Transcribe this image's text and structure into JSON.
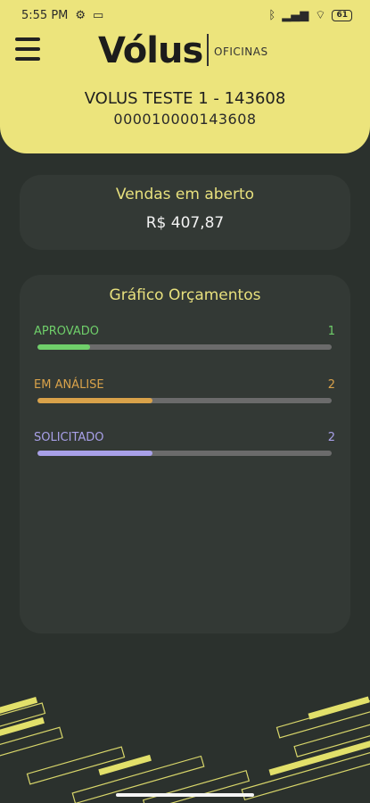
{
  "status_bar": {
    "time": "5:55 PM",
    "battery": "61"
  },
  "header": {
    "logo_text": "Vólus",
    "logo_sub": "OFICINAS",
    "account_name": "VOLUS TESTE 1 - 143608",
    "account_number": "000010000143608"
  },
  "sales": {
    "title": "Vendas em aberto",
    "value": "R$ 407,87"
  },
  "chart": {
    "title": "Gráfico Orçamentos",
    "colors": {
      "accent": "#e7e07d",
      "header_bg": "#ece47c",
      "bg": "#2b312d",
      "card": "#333935"
    }
  },
  "chart_data": {
    "type": "bar",
    "title": "Gráfico Orçamentos",
    "categories": [
      "APROVADO",
      "EM ANÁLISE",
      "SOLICITADO"
    ],
    "values": [
      1,
      2,
      2
    ],
    "fill_fraction": [
      0.18,
      0.39,
      0.39
    ],
    "colors": [
      "#6fcf6a",
      "#d9a24a",
      "#a8a0e8"
    ]
  }
}
